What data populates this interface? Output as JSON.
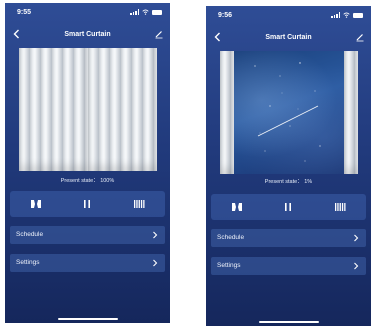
{
  "screens": [
    {
      "status_time": "9:55",
      "title": "Smart Curtain",
      "present_state_label": "Present state：",
      "present_state_value": "100%",
      "open_percent": 100,
      "menu": [
        {
          "label": "Schedule"
        },
        {
          "label": "Settings"
        }
      ]
    },
    {
      "status_time": "9:56",
      "title": "Smart Curtain",
      "present_state_label": "Present state：",
      "present_state_value": "1%",
      "open_percent": 1,
      "menu": [
        {
          "label": "Schedule"
        },
        {
          "label": "Settings"
        }
      ]
    }
  ],
  "colors": {
    "background_top": "#2f4d96",
    "background_bottom": "#15275c",
    "control_bar": "#3c5faa",
    "text": "#ffffff"
  },
  "icons": {
    "back": "chevron-left-icon",
    "edit": "pencil-icon",
    "open": "open-curtain-icon",
    "pause": "pause-icon",
    "close": "close-curtain-icon",
    "row_arrow": "chevron-right-icon"
  }
}
